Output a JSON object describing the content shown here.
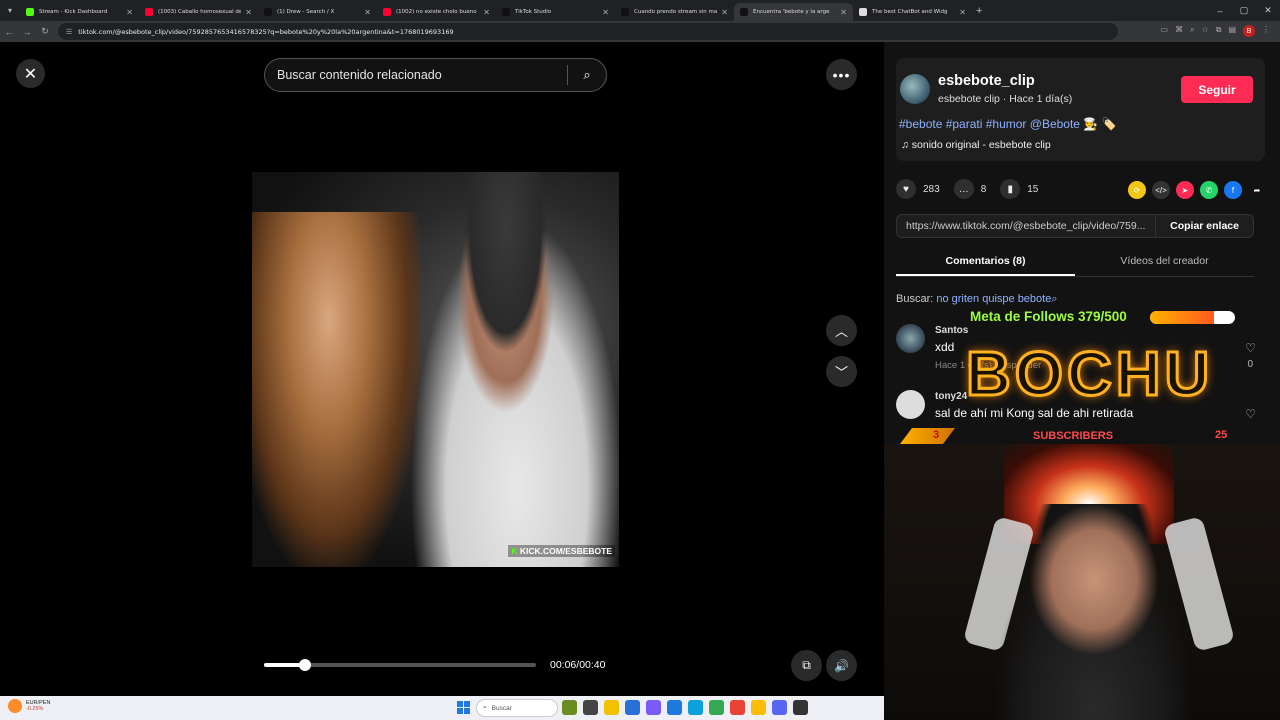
{
  "browser": {
    "tabs": [
      {
        "title": "Stream - Kick Dashboard",
        "color": "#53fc18"
      },
      {
        "title": "(1003) Caballo homosexual de",
        "color": "#ff0033"
      },
      {
        "title": "(1) Drew - Search / X",
        "color": "#111111"
      },
      {
        "title": "(1002) no existe cholo bueno",
        "color": "#ff0033"
      },
      {
        "title": "TikTok Studio",
        "color": "#111111"
      },
      {
        "title": "Cuando prendo stream sin ma",
        "color": "#111111"
      },
      {
        "title": "Encuentra 'bebote y la arge",
        "color": "#111111"
      },
      {
        "title": "The best ChatBot and Widg",
        "color": "#dddddd"
      }
    ],
    "url": "tiktok.com/@esbebote_clip/video/7592857653416578325?q=bebote%20y%20la%20argentina&t=1768019693169",
    "profile_initial": "B"
  },
  "video": {
    "search_placeholder": "Buscar contenido relacionado",
    "watermark_brand": "K",
    "watermark_text": "KICK.COM/ESBEBOTE",
    "time": "00:06/00:40",
    "progress_fraction": 0.15
  },
  "panel": {
    "username": "esbebote_clip",
    "subline": "esbebote clip · Hace 1 día(s)",
    "follow": "Seguir",
    "hashtags": "#bebote #parati #humor @Bebote 🧑‍🍳 🏷️",
    "sound": "♫  sonido original - esbebote clip",
    "likes": "283",
    "comments": "8",
    "saves": "15",
    "link": "https://www.tiktok.com/@esbebote_clip/video/759...",
    "copy": "Copiar enlace",
    "tab_comments": "Comentarios (8)",
    "tab_creator": "Vídeos del creador",
    "search_label": "Buscar:",
    "search_query": "no griten quispe bebote",
    "comment_list": [
      {
        "name": "Santos",
        "text": "xdd",
        "meta": "Hace 1 día(s)   Responder",
        "likes": "0"
      },
      {
        "name": "tony24",
        "text": "sal de ahí mi Kong sal de ahi retirada",
        "meta": "",
        "likes": ""
      }
    ]
  },
  "overlay": {
    "goal_text": "Meta de Follows 379/500",
    "goal_fraction": 0.758,
    "logo": "BOCHU",
    "subs_left": "3",
    "subs_label": "SUBSCRIBERS",
    "subs_right": "25"
  },
  "taskbar": {
    "weather_line1": "EUR/PEN",
    "weather_line2": "-0.25%",
    "search_placeholder": "Buscar"
  }
}
